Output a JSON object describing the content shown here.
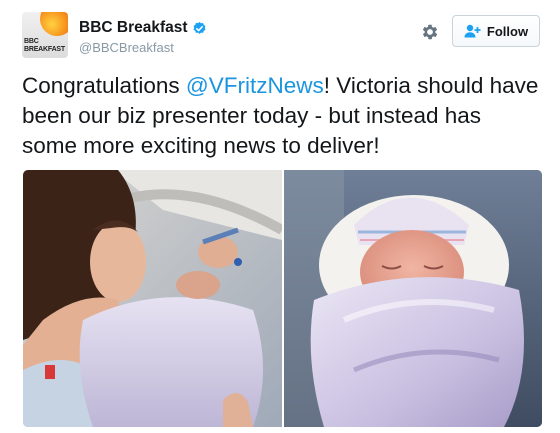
{
  "account": {
    "display_name": "BBC Breakfast",
    "handle": "@BBCBreakfast",
    "avatar_text_line1": "BBC",
    "avatar_text_line2": "BREAKFAST"
  },
  "actions": {
    "follow_label": "Follow"
  },
  "tweet": {
    "text_part1": "Congratulations ",
    "mention": "@VFritzNews",
    "text_part2": "! Victoria should have been our biz presenter today - but instead has some more exciting news to deliver!"
  },
  "icons": {
    "verified": "verified-badge-icon",
    "settings": "gear-icon",
    "follow": "add-user-icon"
  },
  "colors": {
    "mention": "#1b95e0",
    "verified": "#1da1f2",
    "handle": "#8899a6"
  }
}
